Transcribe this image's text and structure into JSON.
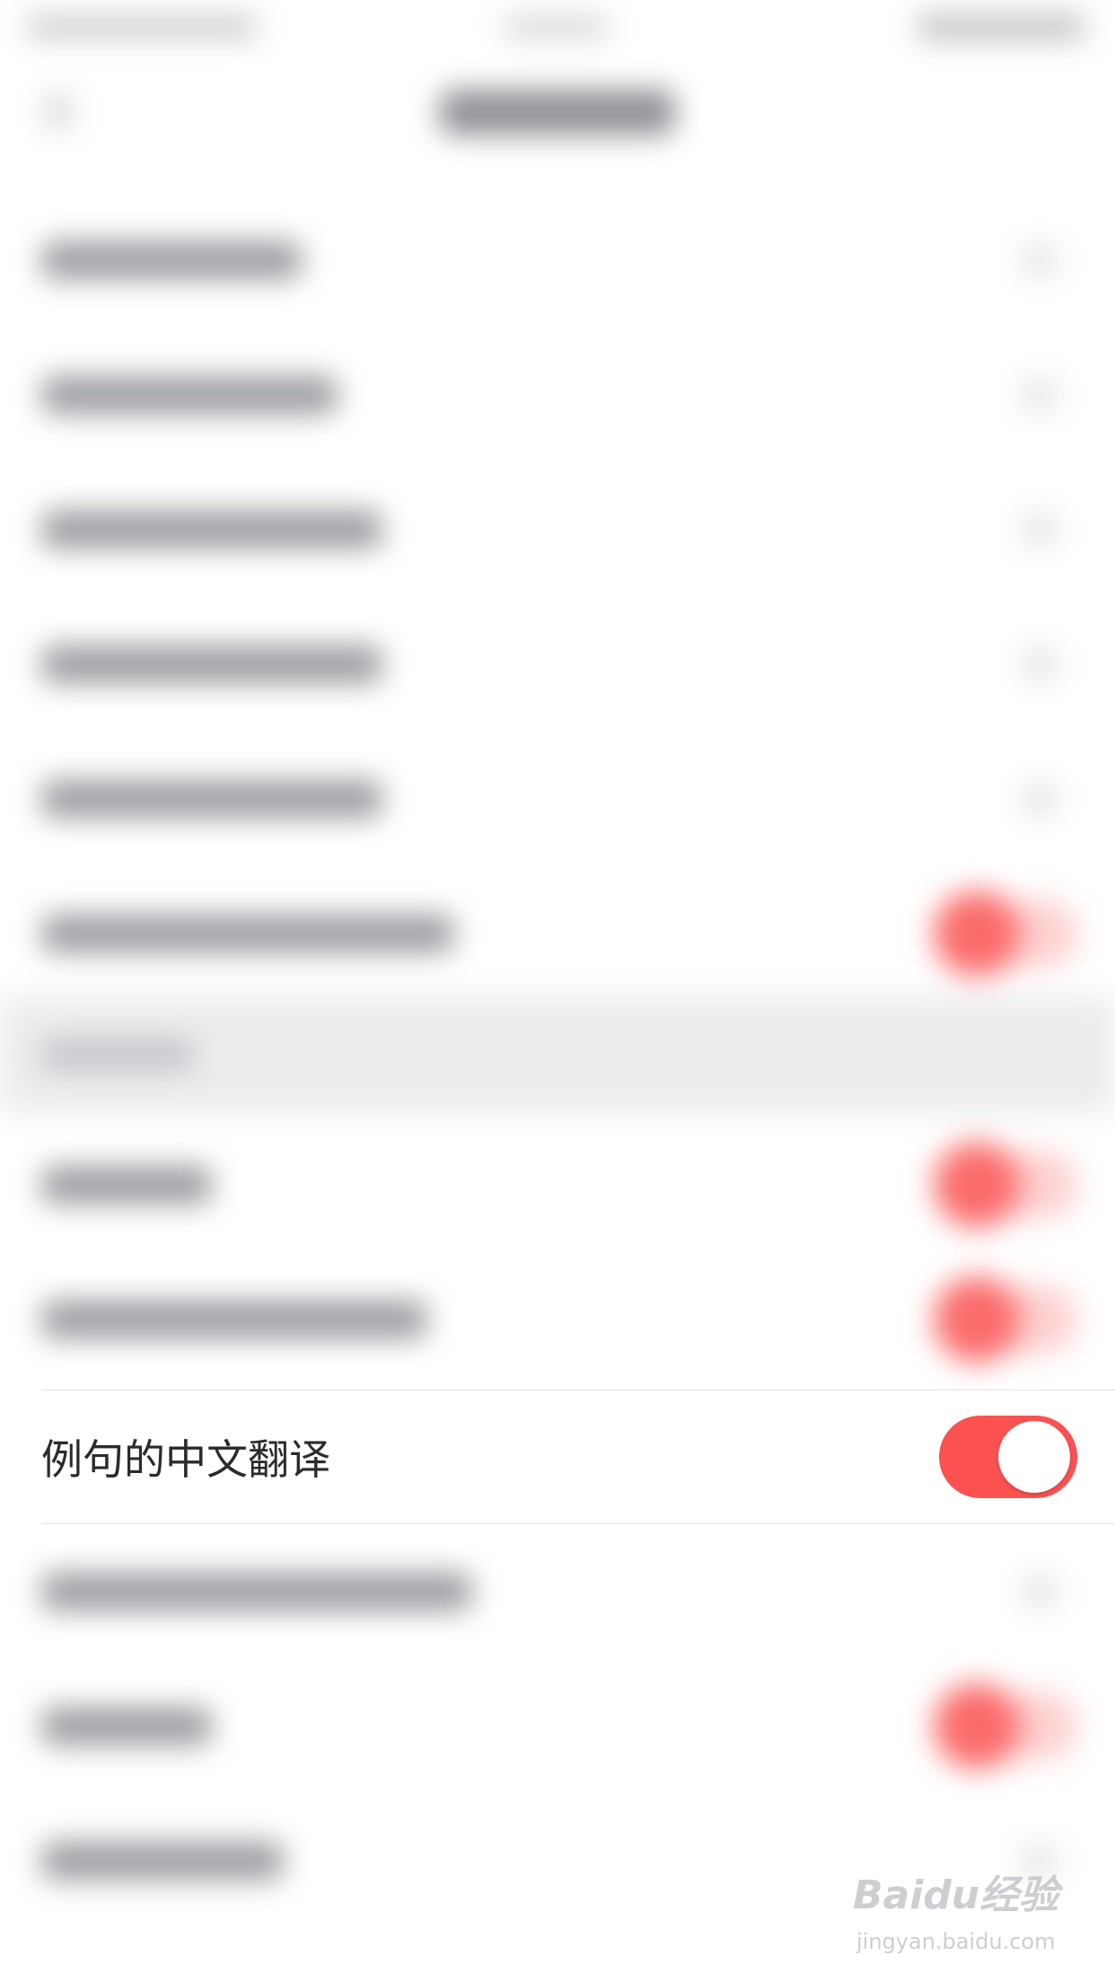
{
  "focused_setting": {
    "label": "例句的中文翻译",
    "enabled": true
  },
  "watermark": {
    "brand": "Baidu经验",
    "url": "jingyan.baidu.com"
  },
  "colors": {
    "toggle_on": "#fb5151",
    "background": "#ffffff",
    "section_header_bg": "#ececee"
  }
}
